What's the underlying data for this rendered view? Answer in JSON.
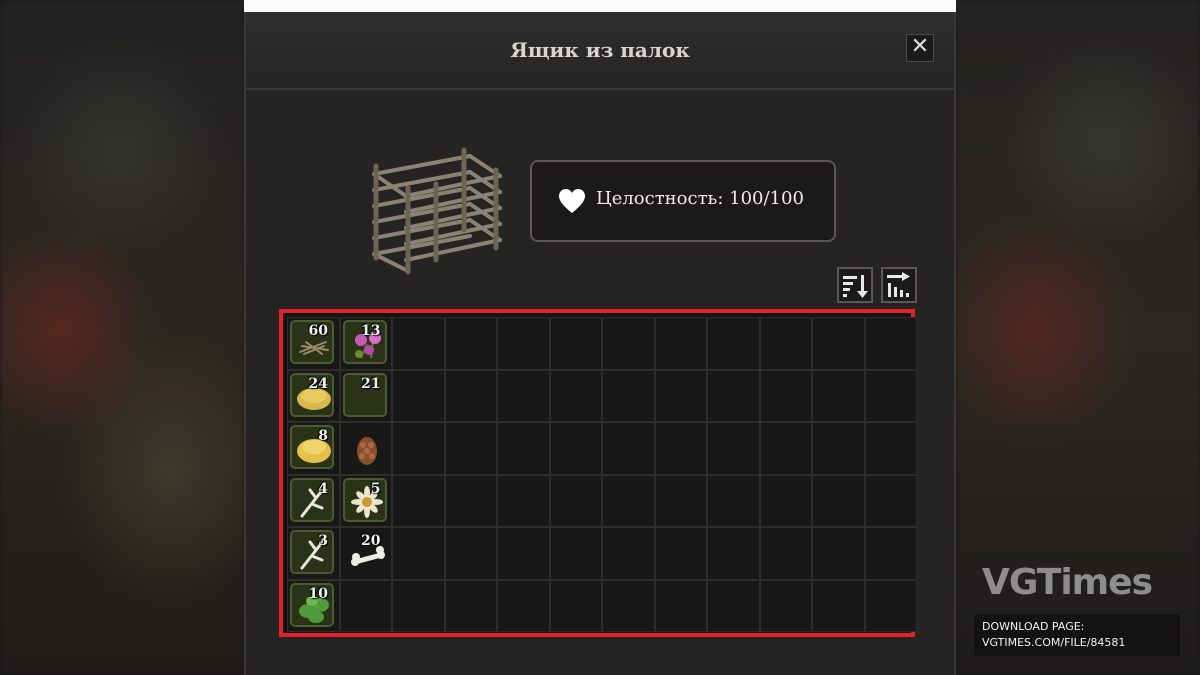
{
  "window": {
    "title": "Ящик из палок",
    "close_symbol": "✕"
  },
  "integrity": {
    "label": "Целостность: 100/100",
    "icon": "heart-icon"
  },
  "toolbar": {
    "sort_icon": "sort-descending-icon",
    "transfer_icon": "transfer-items-icon"
  },
  "inventory": {
    "columns": 12,
    "rows": 6,
    "items": [
      {
        "name": "sticks",
        "qty": "60",
        "icon": "sticks-icon"
      },
      {
        "name": "flowers",
        "qty": "13",
        "icon": "pink-flower-icon"
      },
      {
        "name": "straw-pile",
        "qty": "24",
        "icon": "straw-icon"
      },
      {
        "name": "empty-stack",
        "qty": "21",
        "icon": ""
      },
      {
        "name": "yellow-pile",
        "qty": "8",
        "icon": "yellow-pile-icon"
      },
      {
        "name": "pine-cone",
        "qty": "",
        "icon": "pine-cone-icon"
      },
      {
        "name": "branch",
        "qty": "4",
        "icon": "branch-icon"
      },
      {
        "name": "daisy",
        "qty": "5",
        "icon": "daisy-icon"
      },
      {
        "name": "branch-2",
        "qty": "3",
        "icon": "branch-icon"
      },
      {
        "name": "bone",
        "qty": "20",
        "icon": "bone-icon"
      },
      {
        "name": "leaves",
        "qty": "10",
        "icon": "leaf-icon"
      }
    ]
  },
  "watermark": {
    "brand": "VGTimes",
    "line1": "DOWNLOAD PAGE:",
    "line2": "VGTIMES.COM/FILE/84581"
  }
}
